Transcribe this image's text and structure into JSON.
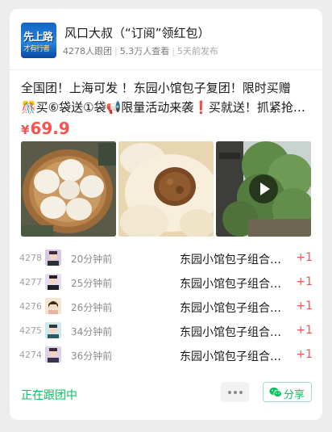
{
  "group": {
    "avatar_text_1": "先上路",
    "avatar_text_2": "才有行者",
    "title": "风口大叔（“订阅”领红包）",
    "followers": "4278人跟团",
    "views": "5.3万人查看",
    "posted": "5天前发布"
  },
  "post": {
    "line1": "全国团！上海可发 ！东园小馆包子复团！限时买赠",
    "line2": "🎊买⑥袋送①袋📢限量活动来袭❗买就送！抓紧抢…",
    "currency": "¥",
    "price": "69.9"
  },
  "media": {
    "video_icon": "play-icon"
  },
  "orders": [
    {
      "num": "4278",
      "time": "20分钟前",
      "goods": "东园小馆包子组合…",
      "qty": "+1"
    },
    {
      "num": "4277",
      "time": "25分钟前",
      "goods": "东园小馆包子组合…",
      "qty": "+1"
    },
    {
      "num": "4276",
      "time": "26分钟前",
      "goods": "东园小馆包子组合…",
      "qty": "+1"
    },
    {
      "num": "4275",
      "time": "34分钟前",
      "goods": "东园小馆包子组合…",
      "qty": "+1"
    },
    {
      "num": "4274",
      "time": "36分钟前",
      "goods": "东园小馆包子组合…",
      "qty": "+1"
    }
  ],
  "footer": {
    "status": "正在跟团中",
    "more_icon": "more-dots-icon",
    "share_label": "分享",
    "share_icon": "wechat-icon"
  },
  "colors": {
    "accent_green": "#07c160",
    "price_red": "#fa5151"
  }
}
